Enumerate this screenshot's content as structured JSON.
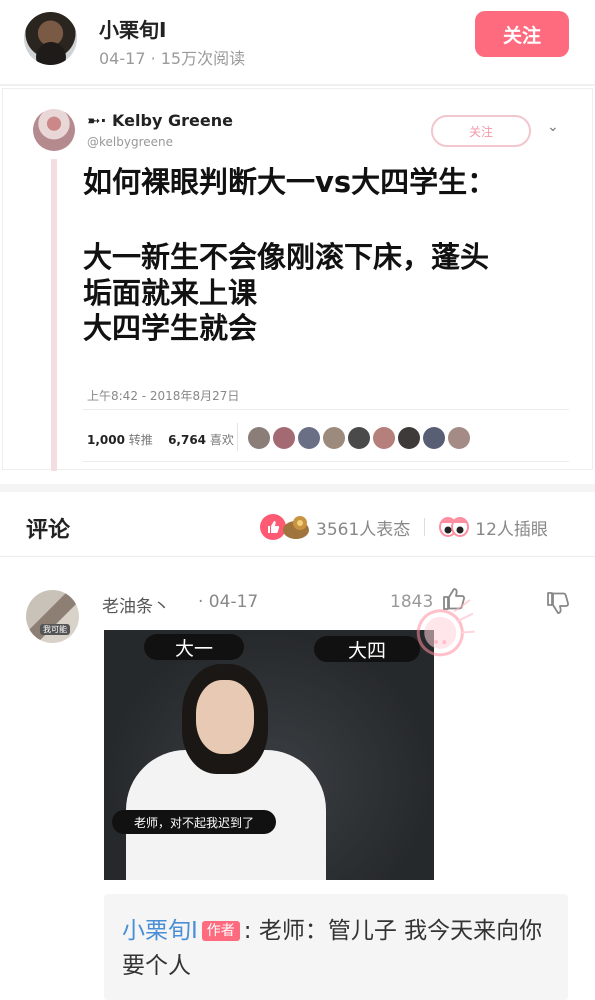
{
  "post": {
    "author": "小栗旬I",
    "meta": "04-17 · 15万次阅读",
    "follow_label": "关注"
  },
  "tweet": {
    "name": "➼· Kelby Greene",
    "handle": "@kelbygreene",
    "follow_label": "关注",
    "lines": [
      "如何裸眼判断大一vs大四学生：",
      "大一新生不会像刚滚下床，蓬头",
      "垢面就来上课",
      "大四学生就会"
    ],
    "time": "上午8:42 - 2018年8月27日",
    "retweets_value": "1,000",
    "retweets_label": "转推",
    "likes_value": "6,764",
    "likes_label": "喜欢"
  },
  "comments_header": {
    "title": "评论",
    "reactions": "3561人表态",
    "eyes": "12人插眼"
  },
  "comment": {
    "name": "老油条丶",
    "date": "· 04-17",
    "likes": "1843",
    "avatar_badge": "我可能",
    "image": {
      "label_left": "大一",
      "label_right": "大四",
      "subtitle": "老师，对不起我迟到了"
    },
    "reply": {
      "author": "小栗旬I",
      "tag": "作者",
      "text": ": 老师：管儿子 我今天来向你要个人"
    }
  },
  "colors": {
    "accent": "#ff6b7e",
    "link": "#4a8fd6"
  }
}
